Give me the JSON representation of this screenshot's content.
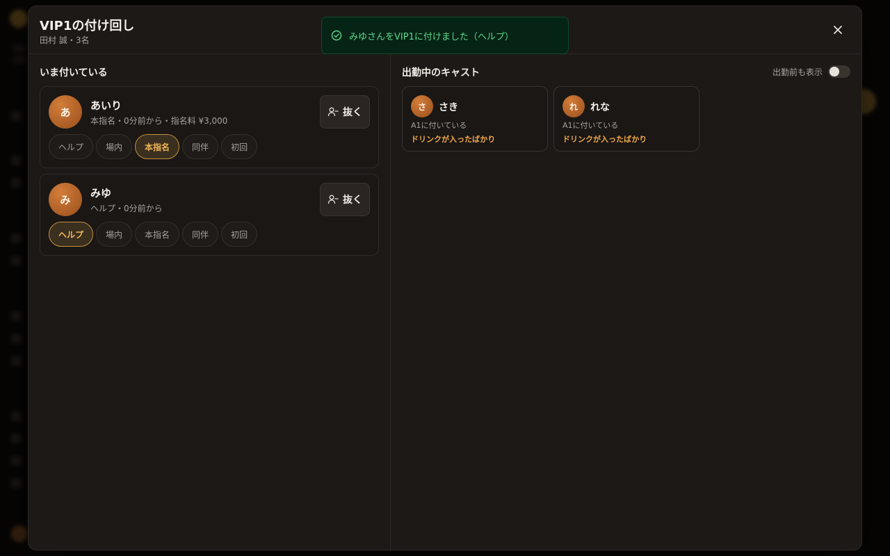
{
  "modal": {
    "title": "VIP1の付け回し",
    "subtitle": "田村 誠・3名",
    "close_label": "×"
  },
  "toast": {
    "message": "みゆさんをVIP1に付けました（ヘルプ）",
    "color": "#5fd68e"
  },
  "current": {
    "title": "いま付いている",
    "remove_label": "抜く",
    "casts": [
      {
        "initial": "あ",
        "name": "あいり",
        "meta": "本指名・0分前から・指名料 ¥3,000",
        "chips": [
          "ヘルプ",
          "場内",
          "本指名",
          "同伴",
          "初回"
        ],
        "active_chip": "本指名"
      },
      {
        "initial": "み",
        "name": "みゆ",
        "meta": "ヘルプ・0分前から",
        "chips": [
          "ヘルプ",
          "場内",
          "本指名",
          "同伴",
          "初回"
        ],
        "active_chip": "ヘルプ"
      }
    ]
  },
  "available": {
    "title": "出勤中のキャスト",
    "toggle_label": "出勤前も表示",
    "toggle_on": false,
    "casts": [
      {
        "initial": "さ",
        "name": "さき",
        "status": "A1に付いている",
        "note": "ドリンクが入ったばかり"
      },
      {
        "initial": "れ",
        "name": "れな",
        "status": "A1に付いている",
        "note": "ドリンクが入ったばかり"
      }
    ]
  },
  "colors": {
    "accent": "#f0b75a",
    "warning_note": "#f0a94a",
    "toast_bg": "#052415"
  }
}
